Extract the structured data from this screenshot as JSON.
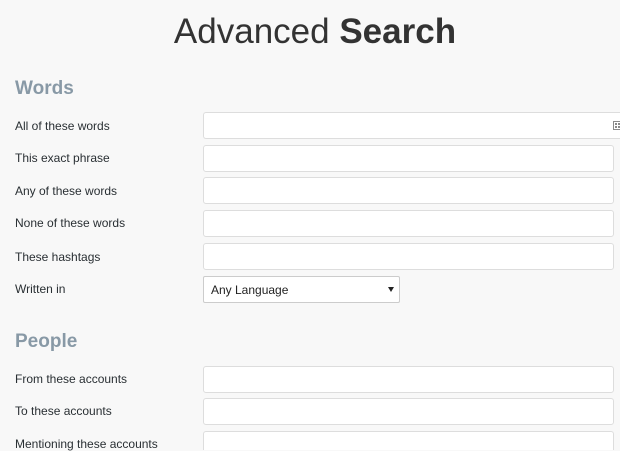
{
  "header": {
    "title_light": "Advanced ",
    "title_bold": "Search"
  },
  "words": {
    "heading": "Words",
    "fields": [
      {
        "label": "All of these words",
        "value": "",
        "placeholder": ""
      },
      {
        "label": "This exact phrase",
        "value": "",
        "placeholder": ""
      },
      {
        "label": "Any of these words",
        "value": "",
        "placeholder": ""
      },
      {
        "label": "None of these words",
        "value": "",
        "placeholder": ""
      },
      {
        "label": "These hashtags",
        "value": "",
        "placeholder": ""
      }
    ],
    "language": {
      "label": "Written in",
      "selected": "Any Language"
    }
  },
  "people": {
    "heading": "People",
    "fields": [
      {
        "label": "From these accounts",
        "value": "",
        "placeholder": ""
      },
      {
        "label": "To these accounts",
        "value": "",
        "placeholder": ""
      },
      {
        "label": "Mentioning these accounts",
        "value": "",
        "placeholder": ""
      }
    ]
  },
  "icons": {
    "input_tool": "keyboard-icon"
  },
  "colors": {
    "heading": "#8899a6",
    "text": "#292f33",
    "background": "#f8f8f8",
    "input_border": "#dddddd"
  }
}
